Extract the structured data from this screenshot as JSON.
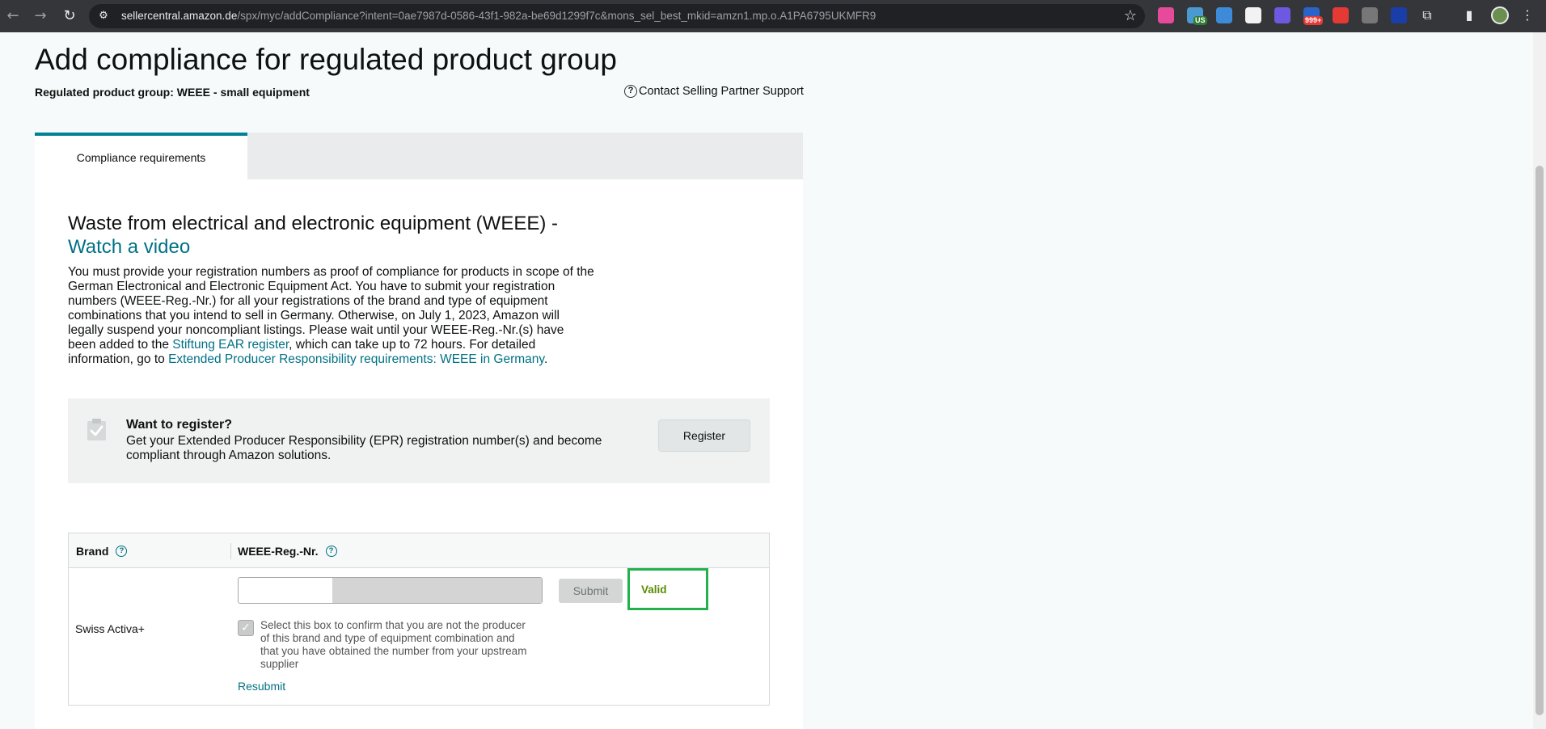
{
  "browser": {
    "url_host": "sellercentral.amazon.de",
    "url_path": "/spx/myc/addCompliance?intent=0ae7987d-0586-43f1-982a-be69d1299f7c&mons_sel_best_mkid=amzn1.mp.o.A1PA6795UKMFR9",
    "extensions": [
      {
        "name": "extension-icon",
        "color": "#e64a9a",
        "badge": ""
      },
      {
        "name": "extension-icon",
        "color": "#4a9ad1",
        "badge": "US",
        "badge_color": "#2e7d32"
      },
      {
        "name": "extension-icon",
        "color": "#3d8bd8",
        "badge": ""
      },
      {
        "name": "extension-icon",
        "color": "#f2f2f2",
        "badge": ""
      },
      {
        "name": "extension-icon",
        "color": "#6b5ae0",
        "badge": ""
      },
      {
        "name": "extension-icon",
        "color": "#2a64c8",
        "badge": "999+",
        "badge_color": "#e53935"
      },
      {
        "name": "extension-icon",
        "color": "#e53935",
        "badge": ""
      },
      {
        "name": "extension-icon",
        "color": "#777777",
        "badge": ""
      },
      {
        "name": "extension-icon",
        "color": "#1a3ea8",
        "badge": ""
      }
    ]
  },
  "page": {
    "title": "Add compliance for regulated product group",
    "group_label": "Regulated product group:",
    "group_value": "WEEE - small equipment",
    "contact_link": "Contact Selling Partner Support",
    "tab_label": "Compliance requirements"
  },
  "section": {
    "title": "Waste from electrical and electronic equipment (WEEE) -",
    "video_link": "Watch a video",
    "desc_1": "You must provide your registration numbers as proof of compliance for products in scope of the German Electronical and Electronic Equipment Act. You have to submit your registration numbers (WEEE-Reg.-Nr.) for all your registrations of the brand and type of equipment combinations that you intend to sell in Germany. Otherwise, on July 1, 2023, Amazon will legally suspend your noncompliant listings. Please wait until your WEEE-Reg.-Nr.(s) have been added to the ",
    "desc_link_1": "Stiftung EAR register",
    "desc_2": ", which can take up to 72 hours. For detailed information, go to ",
    "desc_link_2": "Extended Producer Responsibility requirements: WEEE in Germany",
    "desc_3": "."
  },
  "register": {
    "heading": "Want to register?",
    "text": "Get your Extended Producer Responsibility (EPR) registration number(s) and become compliant through Amazon solutions.",
    "button": "Register"
  },
  "table": {
    "col_brand": "Brand",
    "col_reg": "WEEE-Reg.-Nr.",
    "brand": "Swiss Activa+",
    "reg_value": "",
    "submit": "Submit",
    "status": "Valid",
    "checkbox_label": "Select this box to confirm that you are not the producer of this brand and type of equipment combination and that you have obtained the number from your upstream supplier",
    "resubmit": "Resubmit"
  },
  "colors": {
    "accent": "#007185",
    "tab_border": "#008296",
    "valid_text": "#578c00",
    "highlight_box": "#22b14c"
  }
}
